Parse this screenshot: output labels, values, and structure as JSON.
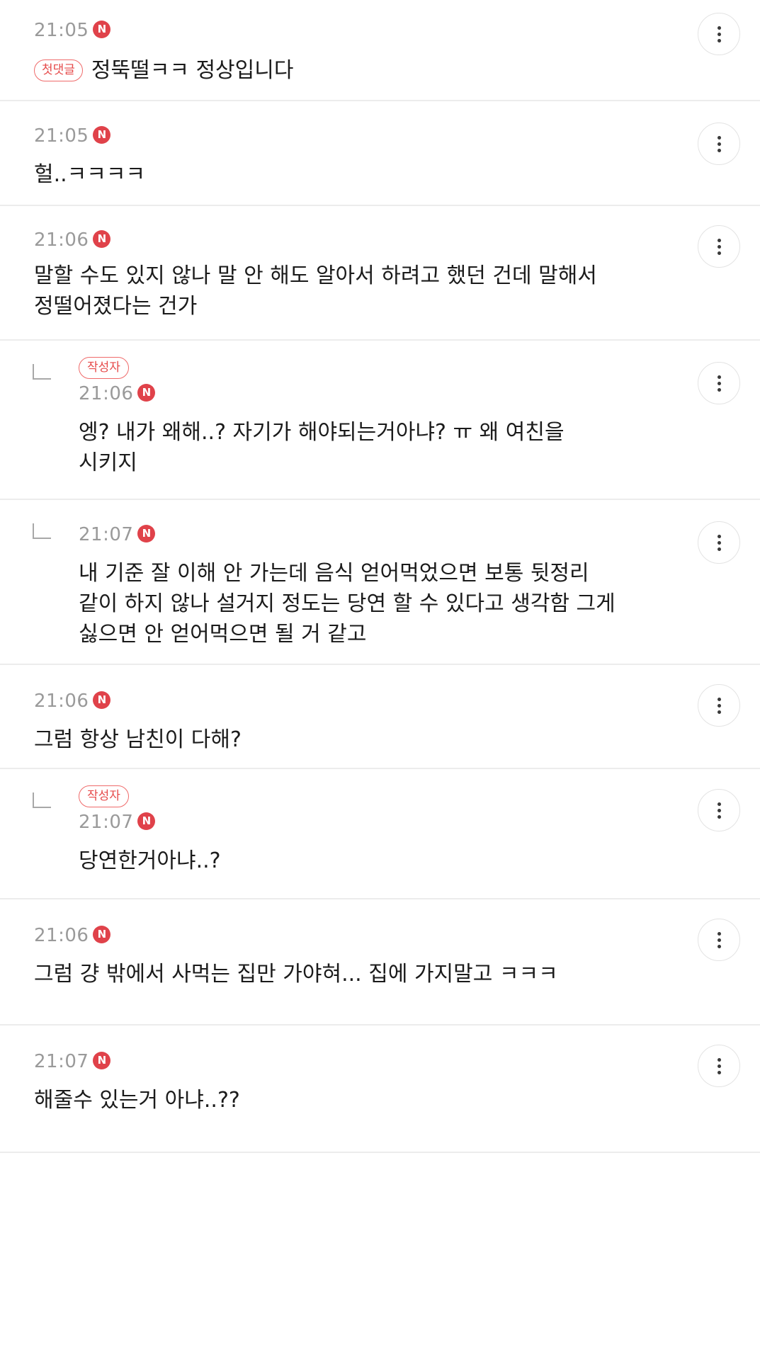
{
  "comments": [
    {
      "time": "21:05",
      "n": "N",
      "first_badge": "첫댓글",
      "text": "정뚝떨ㅋㅋ 정상입니다"
    },
    {
      "time": "21:05",
      "n": "N",
      "text": "헐..ㅋㅋㅋㅋ"
    },
    {
      "time": "21:06",
      "n": "N",
      "text": "말할 수도 있지 않나 말 안 해도 알아서 하려고 했던 건데 말해서\n정떨어졌다는 건가"
    },
    {
      "time": "21:06",
      "n": "N",
      "author_badge": "작성자",
      "text": "엥? 내가 왜해..? 자기가 해야되는거아냐? ㅠ 왜 여친을\n시키지"
    },
    {
      "time": "21:07",
      "n": "N",
      "text": "내 기준 잘 이해 안 가는데 음식 얻어먹었으면 보통 뒷정리\n같이 하지 않나 설거지 정도는 당연 할 수 있다고 생각함 그게\n싫으면 안 얻어먹으면 될 거 같고"
    },
    {
      "time": "21:06",
      "n": "N",
      "text": "그럼 항상 남친이 다해?"
    },
    {
      "time": "21:07",
      "n": "N",
      "author_badge": "작성자",
      "text": "당연한거아냐..?"
    },
    {
      "time": "21:06",
      "n": "N",
      "text": "그럼 걍 밖에서 사먹는 집만 가야혀... 집에 가지말고 ㅋㅋㅋ"
    },
    {
      "time": "21:07",
      "n": "N",
      "text": "해줄수 있는거 아냐..??"
    }
  ],
  "icons": {
    "more": "more-vertical-icon",
    "reply": "reply-arrow-icon",
    "new": "new-badge-icon"
  },
  "colors": {
    "accent": "#e0424a",
    "badge_border": "#ef6a6a",
    "time": "#9a9a9a",
    "divider": "#ececec"
  }
}
